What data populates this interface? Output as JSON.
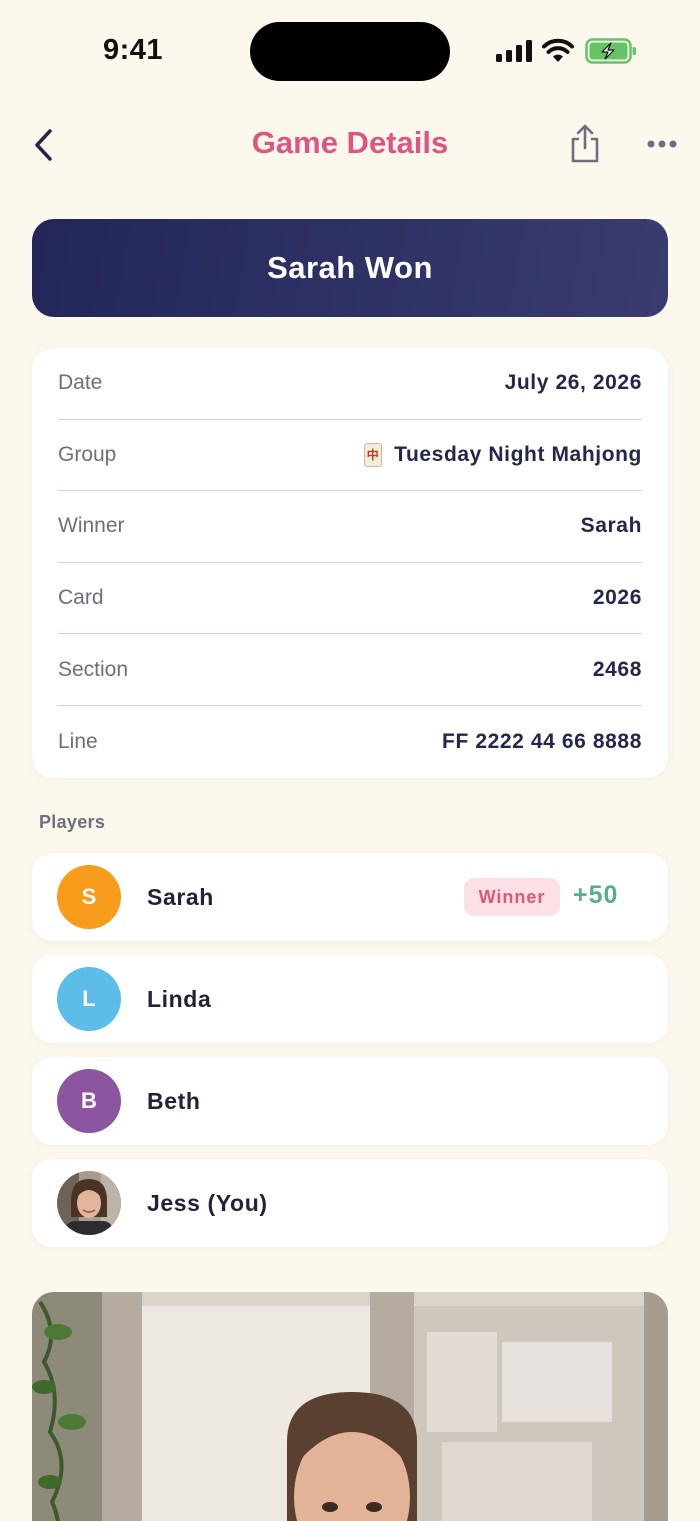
{
  "status_bar": {
    "time": "9:41"
  },
  "nav": {
    "title": "Game Details"
  },
  "banner": {
    "text": "Sarah Won"
  },
  "details": [
    {
      "label": "Date",
      "value": "July 26, 2026"
    },
    {
      "label": "Group",
      "value": "Tuesday Night Mahjong",
      "icon": "mahjong-tile-icon",
      "icon_glyph": "中"
    },
    {
      "label": "Winner",
      "value": "Sarah"
    },
    {
      "label": "Card",
      "value": "2026"
    },
    {
      "label": "Section",
      "value": "2468"
    },
    {
      "label": "Line",
      "value": "FF 2222 44 66 8888"
    }
  ],
  "players_section": {
    "label": "Players"
  },
  "players": [
    {
      "initial": "S",
      "name": "Sarah",
      "color": "#F79C1B",
      "badge": "Winner",
      "points": "+50"
    },
    {
      "initial": "L",
      "name": "Linda",
      "color": "#5BBDE8"
    },
    {
      "initial": "B",
      "name": "Beth",
      "color": "#8C55A0"
    },
    {
      "name": "Jess (You)",
      "photo": true
    }
  ],
  "colors": {
    "background": "#FDF8EE",
    "accent": "#E0557F",
    "banner": "#23265A",
    "points": "#5BAE8B"
  }
}
